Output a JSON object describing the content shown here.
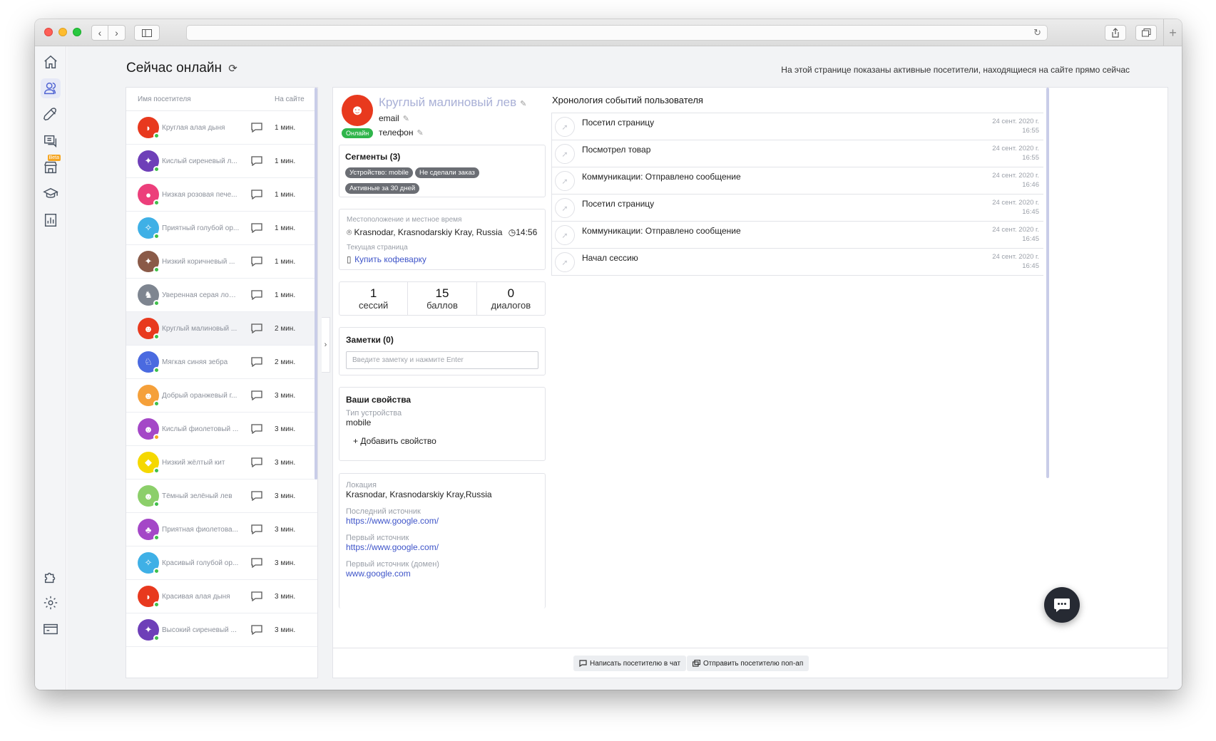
{
  "page": {
    "title": "Сейчас онлайн",
    "reload_glyph": "⟳",
    "description": "На этой странице показаны активные посетители, находящиеся на сайте прямо сейчас"
  },
  "nav_icons": [
    "home-icon",
    "users-icon",
    "rocket-icon",
    "chat-list-icon",
    "store-icon",
    "graduation-cap-icon",
    "report-icon",
    "puzzle-icon",
    "gear-icon",
    "billing-card-icon"
  ],
  "store_beta_label": "Beta",
  "visitor_list": {
    "header_name": "Имя посетителя",
    "header_time": "На сайте",
    "rows": [
      {
        "name": "Круглая алая дыня",
        "time": "1 мин.",
        "color": "#e8391e",
        "glyph": "◗",
        "status": "#3fbf4a"
      },
      {
        "name": "Кислый сиреневый л...",
        "time": "1 мин.",
        "color": "#6e3fb8",
        "glyph": "✦",
        "status": "#3fbf4a"
      },
      {
        "name": "Низкая розовая пече...",
        "time": "1 мин.",
        "color": "#ec3f7b",
        "glyph": "●",
        "status": "#3fbf4a"
      },
      {
        "name": "Приятный голубой ор...",
        "time": "1 мин.",
        "color": "#3fb0e6",
        "glyph": "✧",
        "status": "#3fbf4a"
      },
      {
        "name": "Низкий коричневый ...",
        "time": "1 мин.",
        "color": "#8a5a48",
        "glyph": "✦",
        "status": "#3fbf4a"
      },
      {
        "name": "Уверенная серая лош...",
        "time": "1 мин.",
        "color": "#7e8590",
        "glyph": "♞",
        "status": "#3fbf4a"
      },
      {
        "name": "Круглый малиновый ...",
        "time": "2 мин.",
        "color": "#e8391e",
        "glyph": "☻",
        "status": "#3fbf4a"
      },
      {
        "name": "Мягкая синяя зебра",
        "time": "2 мин.",
        "color": "#4a6ae0",
        "glyph": "♘",
        "status": "#3fbf4a"
      },
      {
        "name": "Добрый оранжевый г...",
        "time": "3 мин.",
        "color": "#f5a03a",
        "glyph": "☻",
        "status": "#3fbf4a"
      },
      {
        "name": "Кислый фиолетовый ...",
        "time": "3 мин.",
        "color": "#a447c7",
        "glyph": "☻",
        "status": "#f5a623"
      },
      {
        "name": "Низкий жёлтый кит",
        "time": "3 мин.",
        "color": "#f5d800",
        "glyph": "◆",
        "status": "#3fbf4a"
      },
      {
        "name": "Тёмный зелёный лев",
        "time": "3 мин.",
        "color": "#8ccf6a",
        "glyph": "☻",
        "status": "#3fbf4a"
      },
      {
        "name": "Приятная фиолетова...",
        "time": "3 мин.",
        "color": "#a447c7",
        "glyph": "♣",
        "status": "#3fbf4a"
      },
      {
        "name": "Красивый голубой ор...",
        "time": "3 мин.",
        "color": "#3fb0e6",
        "glyph": "✧",
        "status": "#3fbf4a"
      },
      {
        "name": "Красивая алая дыня",
        "time": "3 мин.",
        "color": "#e8391e",
        "glyph": "◗",
        "status": "#3fbf4a"
      },
      {
        "name": "Высокий сиреневый ...",
        "time": "3 мин.",
        "color": "#6e3fb8",
        "glyph": "✦",
        "status": "#3fbf4a"
      }
    ]
  },
  "profile": {
    "name": "Круглый малиновый лев",
    "email": "email",
    "phone": "телефон",
    "online": "Онлайн",
    "avatar_color": "#e8391e",
    "avatar_glyph": "☻",
    "pencil": "✎"
  },
  "segments": {
    "title": "Сегменты (3)",
    "tags": [
      "Устройство: mobile",
      "Не сделали заказ",
      "Активные за 30 дней"
    ]
  },
  "location": {
    "label": "Местоположение и местное время",
    "place": "Krasnodar, Krasnodarskiy Kray, Russia",
    "time": "14:56",
    "page_label": "Текущая страница",
    "page": "Купить кофеварку"
  },
  "stats": [
    {
      "num": "1",
      "label": "сессий"
    },
    {
      "num": "15",
      "label": "баллов"
    },
    {
      "num": "0",
      "label": "диалогов"
    }
  ],
  "notes": {
    "title": "Заметки (0)",
    "placeholder": "Введите заметку и нажмите Enter"
  },
  "properties": {
    "title": "Ваши свойства",
    "device_label": "Тип устройства",
    "device_value": "mobile",
    "add_label": "Добавить свойство"
  },
  "sources": {
    "location_label": "Локация",
    "location_value": "Krasnodar, Krasnodarskiy Kray,Russia",
    "last_label": "Последний источник",
    "last_value": "https://www.google.com/",
    "first_label": "Первый источник",
    "first_value": "https://www.google.com/",
    "first_domain_label": "Первый источник (домен)",
    "first_domain_value": "www.google.com"
  },
  "timeline": {
    "title": "Хронология событий пользователя",
    "events": [
      {
        "text": "Посетил страницу",
        "date": "24 сент. 2020 г.",
        "time": "16:55"
      },
      {
        "text": "Посмотрел товар",
        "date": "24 сент. 2020 г.",
        "time": "16:55"
      },
      {
        "text": "Коммуникации: Отправлено сообщение",
        "date": "24 сент. 2020 г.",
        "time": "16:46"
      },
      {
        "text": "Посетил страницу",
        "date": "24 сент. 2020 г.",
        "time": "16:45"
      },
      {
        "text": "Коммуникации: Отправлено сообщение",
        "date": "24 сент. 2020 г.",
        "time": "16:45"
      },
      {
        "text": "Начал сессию",
        "date": "24 сент. 2020 г.",
        "time": "16:45"
      }
    ]
  },
  "footer": {
    "chat_btn": "Написать посетителю в чат",
    "popup_btn": "Отправить посетителю поп-ап"
  },
  "colors": {
    "accent": "#4f63d2",
    "online": "#2fb54b",
    "tag": "#6b6e74",
    "link": "#3f55c9"
  }
}
